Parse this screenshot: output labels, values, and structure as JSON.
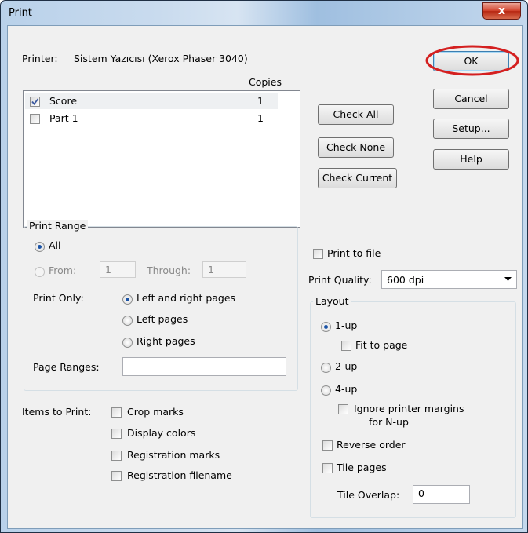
{
  "window": {
    "title": "Print",
    "close_glyph": "x"
  },
  "printer": {
    "label": "Printer:",
    "name": "Sistem Yazıcısı (Xerox Phaser 3040)"
  },
  "parts": {
    "copies_header": "Copies",
    "items": [
      {
        "name": "Score",
        "copies": "1",
        "checked": true
      },
      {
        "name": "Part 1",
        "copies": "1",
        "checked": false
      }
    ]
  },
  "buttons": {
    "ok": "OK",
    "cancel": "Cancel",
    "setup": "Setup...",
    "help": "Help",
    "check_all": "Check All",
    "check_none": "Check None",
    "check_current": "Check Current"
  },
  "print_range": {
    "title": "Print Range",
    "all": "All",
    "from": "From:",
    "from_value": "1",
    "through": "Through:",
    "through_value": "1",
    "print_only": "Print Only:",
    "left_right": "Left and right pages",
    "left": "Left pages",
    "right": "Right pages",
    "page_ranges": "Page Ranges:",
    "page_ranges_value": ""
  },
  "print_to_file": "Print to file",
  "quality": {
    "label": "Print Quality:",
    "value": "600 dpi"
  },
  "layout": {
    "title": "Layout",
    "one_up": "1-up",
    "fit_to_page": "Fit to page",
    "two_up": "2-up",
    "four_up": "4-up",
    "ignore_margins_1": "Ignore printer margins",
    "ignore_margins_2": "for N-up",
    "reverse_order": "Reverse order",
    "tile_pages": "Tile pages",
    "tile_overlap": "Tile Overlap:",
    "tile_overlap_value": "0"
  },
  "items_to_print": {
    "label": "Items to Print:",
    "crop": "Crop marks",
    "display_colors": "Display colors",
    "registration_marks": "Registration marks",
    "registration_filename": "Registration filename"
  },
  "colors": {
    "highlight_ring": "#d42020"
  }
}
